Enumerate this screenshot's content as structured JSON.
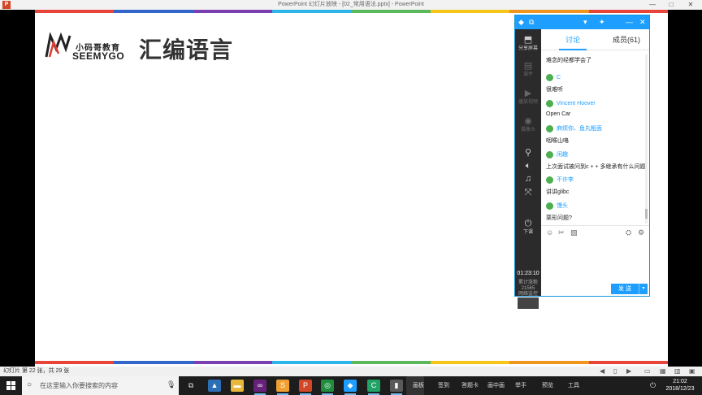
{
  "window": {
    "title": "PowerPoint 幻灯片放映 - [02_常用语法.pptx] - PowerPoint",
    "app_icon_letter": "P"
  },
  "slide": {
    "title": "汇编语言",
    "logo": {
      "cn": "小码哥教育",
      "en": "SEEMYGO"
    },
    "stripe_colors": [
      "#e9443a",
      "#3366cc",
      "#7c3fb1",
      "#2bb5e8",
      "#5cb85c",
      "#f5c518",
      "#f0961f",
      "#e9443a"
    ]
  },
  "chat": {
    "tabs": {
      "discussion": "讨论",
      "members": "成员(61)"
    },
    "sidebar": {
      "share_screen": "分享屏幕",
      "item2": "课件",
      "item3": "播放视频",
      "item4": "摄像头",
      "end_class": "下课",
      "time": "01:23:10",
      "stat_label": "累计涨粉",
      "stat_value": "21565",
      "network_label": "网络监控"
    },
    "messages": [
      {
        "name": "",
        "text": "难念的经都学会了"
      },
      {
        "name": "C",
        "text": "很难听"
      },
      {
        "name": "Vincent Hoover",
        "text": "Open Car"
      },
      {
        "name": "麻烦你、鱼丸粗面",
        "text": "咽喉山咯"
      },
      {
        "name": "闲趣",
        "text": "上次面试被问到c + + 多继承有什么问题"
      },
      {
        "name": "不许李",
        "text": "讲讲glibc"
      },
      {
        "name": "馒头",
        "text": "栗形问题?"
      }
    ],
    "send_label": "发 送"
  },
  "statusbar": {
    "text": "幻灯片 第 22 张，共 29 张"
  },
  "taskbar": {
    "search_placeholder": "在这里输入你要搜索的内容",
    "labels": [
      "画板",
      "签到",
      "答题卡",
      "画中画",
      "举手",
      "预览",
      "工具"
    ],
    "time": "21:02",
    "date": "2018/12/23"
  }
}
